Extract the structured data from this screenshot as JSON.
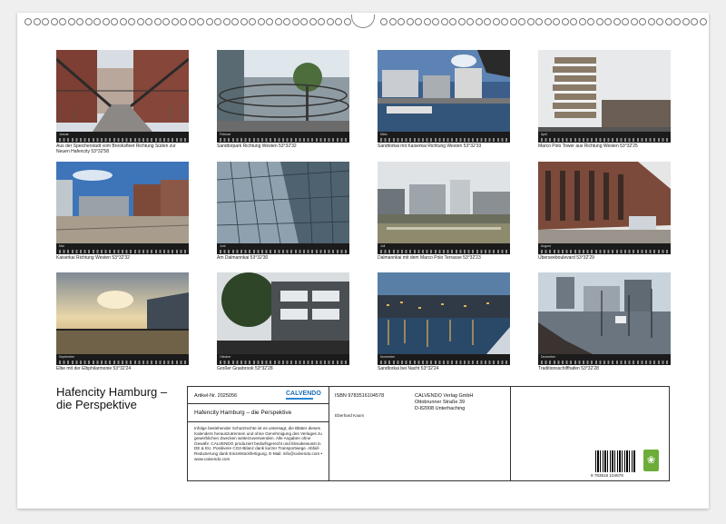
{
  "captions": [
    "Aus der Speicherstadt vom Brooksfleet Richtung Süden zur Neuen Hafencity  53°32'58",
    "Sandtorpark Richtung Westen  53°32'32",
    "Sandtorkai mit Kaiserkai Richtung Westen  53°32'33",
    "Marco Polo Tower aus Richtung Westen  53°32'25",
    "Kaiserkai Richtung Westen  53°32'32",
    "Am Dalmannkai  53°32'30",
    "Dalmannkai mit dem Marco Polo Terrasse  53°32'23",
    "Überseeboulevard  53°32'29",
    "Elbe mit der Elbphilarmonie  53°32'24",
    "Großer Grasbrook  53°32'28",
    "Sandtorkai bei Nacht  53°32'24",
    "Traditionsschiffhafen  53°32'28"
  ],
  "months": [
    "Januar",
    "Februar",
    "März",
    "April",
    "Mai",
    "Juni",
    "Juli",
    "August",
    "September",
    "Oktober",
    "November",
    "Dezember"
  ],
  "title_line1": "Hafencity Hamburg –",
  "title_line2": "die Perspektive",
  "cover": {
    "article": "Artikel-Nr. 2025056",
    "logo": "CALVENDO",
    "isbn": "ISBN 9783516104578",
    "publisher_line1": "CALVENDO Verlag GmbH",
    "publisher_line2": "Ottobrunner Straße 39",
    "publisher_line3": "D-82008 Unterhaching",
    "calendar_title": "Hafencity Hamburg – die Perspektive",
    "author": "Eberhard Kaum",
    "legal": "Infolge bestehender Schutzrechte ist es untersagt, die Blätter dieses Kalenders herauszutrennen und ohne Genehmigung des Verlages zu gewerblichen Zwecken weiterzuverwenden. Alle Angaben ohne Gewähr. CALVENDO produziert bedarfsgerecht und klimabewusst in DE & EU. Positivere CO2-Bilanz dank kurzer Transportwege. Abfall-Reduzierung dank Einzelstückfertigung. E-Mail: info@calvendo.com • www.calvendo.com",
    "barcode_number": "9 783516 104578"
  }
}
